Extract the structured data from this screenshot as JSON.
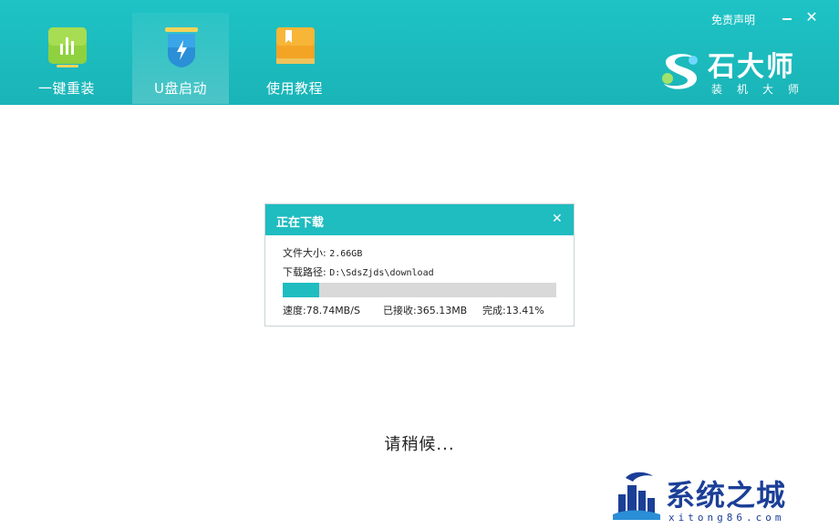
{
  "header": {
    "tabs": [
      {
        "label": "一键重装",
        "icon": "bar-chart-icon",
        "active": false
      },
      {
        "label": "U盘启动",
        "icon": "usb-drive-icon",
        "active": true
      },
      {
        "label": "使用教程",
        "icon": "book-icon",
        "active": false
      }
    ],
    "disclaimer": "免责声明",
    "brand": {
      "name": "石大师",
      "subtitle": "装机大师"
    }
  },
  "dialog": {
    "title": "正在下载",
    "file_size_label": "文件大小:",
    "file_size": "2.66GB",
    "path_label": "下载路径:",
    "path": "D:\\SdsZjds\\download",
    "progress": 0.1341,
    "speed": "速度:78.74MB/S",
    "received": "已接收:365.13MB",
    "completed": "完成:13.41%"
  },
  "status": "请稍候...",
  "watermark": {
    "title": "系统之城",
    "url": "xitong86.com"
  },
  "colors": {
    "accent": "#1fbcc0",
    "header": "#1ec3c5",
    "watermark": "#1b3f97"
  }
}
